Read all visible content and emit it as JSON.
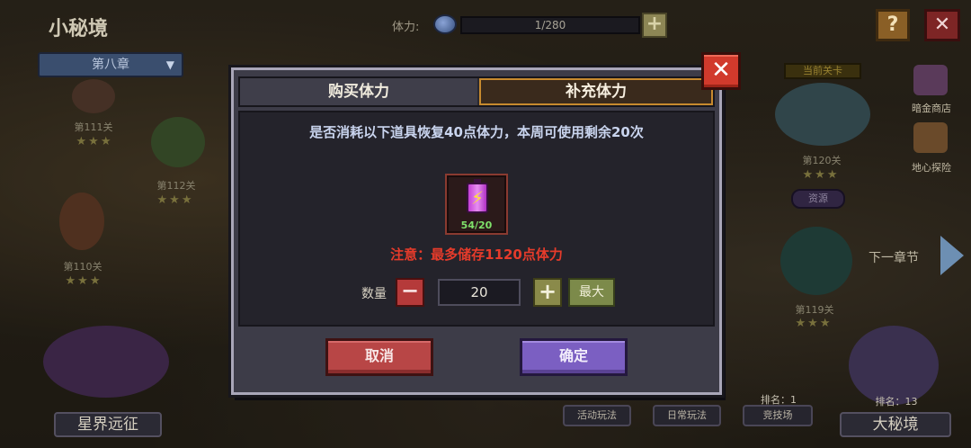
{
  "hud": {
    "title": "小秘境",
    "chapter": "第八章",
    "stamina_label": "体力:",
    "stamina_value": "1/280",
    "add_symbol": "+",
    "help_symbol": "?",
    "close_symbol": "✕"
  },
  "map": {
    "stages": [
      {
        "label": "第111关",
        "stars": "★★★"
      },
      {
        "label": "第112关",
        "stars": "★★★"
      },
      {
        "label": "第110关",
        "stars": "★★★"
      },
      {
        "label": "第120关",
        "stars": "★★★"
      },
      {
        "label": "第119关",
        "stars": "★★★"
      }
    ],
    "current_stage_tag": "当前关卡",
    "resource_tag": "资源",
    "next_chapter": "下一章节"
  },
  "side_menu": {
    "dark_shop": "暗金商店",
    "underground": "地心探险"
  },
  "bottom": {
    "astral": "星界远征",
    "activity": "活动玩法",
    "daily": "日常玩法",
    "arena": "竞技场",
    "arena_rank": "排名：1",
    "big_realm": "大秘境",
    "big_realm_rank": "排名：13"
  },
  "modal": {
    "tab_buy": "购买体力",
    "tab_refill": "补充体力",
    "question": "是否消耗以下道具恢复40点体力，本周可使用剩余20次",
    "item_count": "54/20",
    "bolt": "⚡",
    "warning": "注意：最多储存1120点体力",
    "qty_label": "数量",
    "qty_minus": "−",
    "qty_value": "20",
    "qty_plus": "+",
    "qty_max": "最大",
    "cancel": "取消",
    "confirm": "确定",
    "close_symbol": "✕"
  }
}
